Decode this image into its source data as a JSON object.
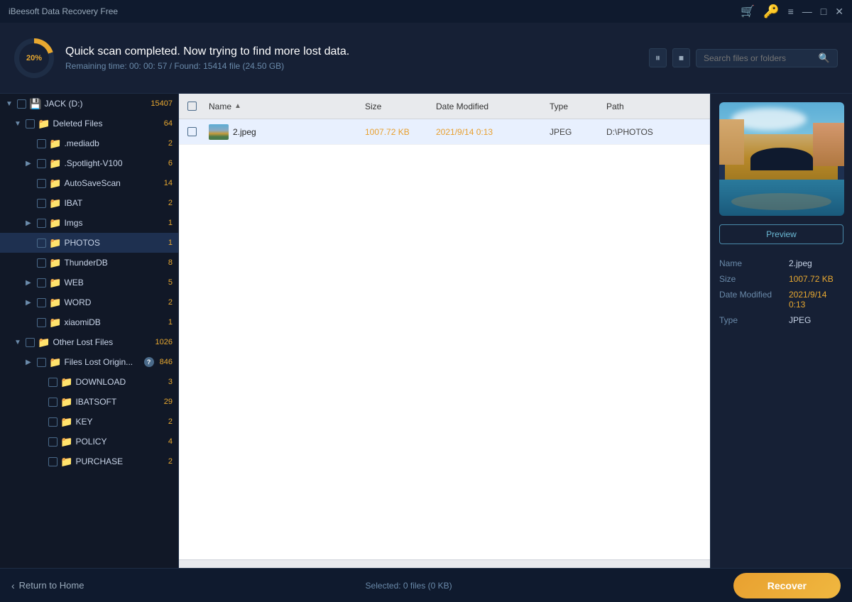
{
  "app": {
    "title": "iBeesoft Data Recovery Free",
    "icons": {
      "cart": "🛒",
      "key": "🔑",
      "menu": "≡",
      "minimize": "—",
      "maximize": "□",
      "close": "✕"
    }
  },
  "header": {
    "progress_percent": "20%",
    "title": "Quick scan completed. Now trying to find more lost data.",
    "subtitle": "Remaining time: 00: 00: 57 / Found: 15414 file (24.50 GB)",
    "search_placeholder": "Search files or folders"
  },
  "sidebar": {
    "drive_label": "JACK (D:)",
    "drive_count": "15407",
    "deleted_files_label": "Deleted Files",
    "deleted_files_count": "64",
    "items": [
      {
        "label": ".mediadb",
        "count": "2",
        "indent": 2
      },
      {
        "label": ".Spotlight-V100",
        "count": "6",
        "indent": 2,
        "expandable": true
      },
      {
        "label": "AutoSaveScan",
        "count": "14",
        "indent": 2
      },
      {
        "label": "IBAT",
        "count": "2",
        "indent": 2
      },
      {
        "label": "Imgs",
        "count": "1",
        "indent": 2,
        "expandable": true
      },
      {
        "label": "PHOTOS",
        "count": "1",
        "indent": 2,
        "selected": true
      },
      {
        "label": "ThunderDB",
        "count": "8",
        "indent": 2
      },
      {
        "label": "WEB",
        "count": "5",
        "indent": 2,
        "expandable": true
      },
      {
        "label": "WORD",
        "count": "2",
        "indent": 2,
        "expandable": true
      },
      {
        "label": "xiaomiDB",
        "count": "1",
        "indent": 2
      }
    ],
    "other_lost_label": "Other Lost Files",
    "other_lost_count": "1026",
    "files_lost_origin_label": "Files Lost Origin...",
    "files_lost_origin_count": "846",
    "other_items": [
      {
        "label": "DOWNLOAD",
        "count": "3",
        "indent": 3
      },
      {
        "label": "IBATSOFT",
        "count": "29",
        "indent": 3
      },
      {
        "label": "KEY",
        "count": "2",
        "indent": 3
      },
      {
        "label": "POLICY",
        "count": "4",
        "indent": 3
      },
      {
        "label": "PURCHASE",
        "count": "2",
        "indent": 3
      }
    ],
    "return_home": "Return to Home"
  },
  "table": {
    "columns": {
      "name": "Name",
      "size": "Size",
      "date_modified": "Date Modified",
      "type": "Type",
      "path": "Path"
    },
    "rows": [
      {
        "name": "2.jpeg",
        "size": "1007.72 KB",
        "date": "2021/9/14 0:13",
        "type": "JPEG",
        "path": "D:\\PHOTOS"
      }
    ]
  },
  "rightpanel": {
    "preview_label": "Preview",
    "meta": {
      "name_key": "Name",
      "name_val": "2.jpeg",
      "size_key": "Size",
      "size_val": "1007.72 KB",
      "date_key": "Date Modified",
      "date_val": "2021/9/14 0:13",
      "type_key": "Type",
      "type_val": "JPEG"
    }
  },
  "bottombar": {
    "selected_info": "Selected: 0 files (0 KB)",
    "recover_label": "Recover"
  }
}
